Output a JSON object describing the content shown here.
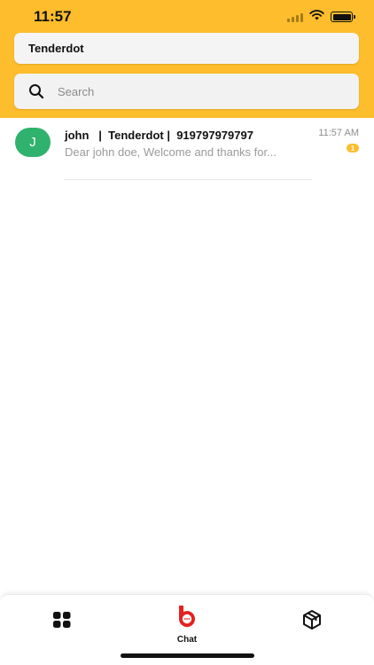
{
  "status_bar": {
    "time": "11:57"
  },
  "header": {
    "title": "Tenderdot",
    "background_color": "#fdbd2c"
  },
  "search": {
    "placeholder": "Search",
    "value": ""
  },
  "chats": [
    {
      "avatar_initial": "J",
      "avatar_color": "#2fb26d",
      "name": "john   |  Tenderdot |  919797979797",
      "preview": "Dear john  doe, Welcome and thanks for...",
      "time": "11:57 AM",
      "unread_count": "1"
    }
  ],
  "tab_bar": {
    "tabs": [
      {
        "icon": "dashboard-grid-icon",
        "label": ""
      },
      {
        "icon": "chat-logo-icon",
        "label": "Chat",
        "active": true,
        "color": "#e52020"
      },
      {
        "icon": "box-icon",
        "label": ""
      }
    ]
  }
}
